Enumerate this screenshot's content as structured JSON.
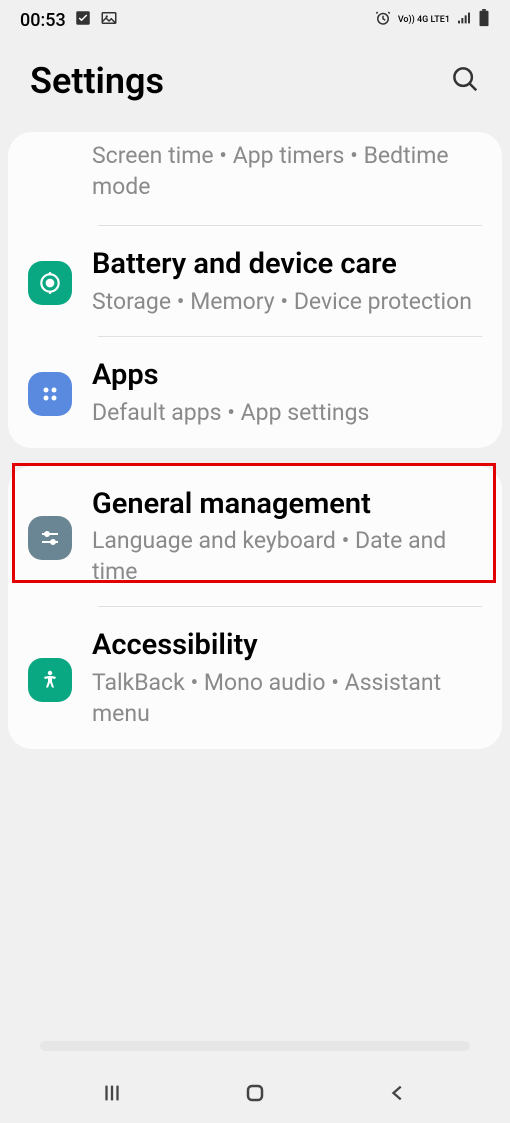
{
  "status_bar": {
    "time": "00:53",
    "network_label": "Vo)) 4G LTE1"
  },
  "header": {
    "title": "Settings"
  },
  "cards": [
    {
      "items": [
        {
          "key": "digital_wellbeing_partial",
          "title": "",
          "subtitle": "Screen time  •  App timers  •  Bedtime mode"
        },
        {
          "key": "battery_device_care",
          "title": "Battery and device care",
          "subtitle": "Storage  •  Memory  •  Device protection"
        },
        {
          "key": "apps",
          "title": "Apps",
          "subtitle": "Default apps  •  App settings",
          "highlighted": true
        }
      ]
    },
    {
      "items": [
        {
          "key": "general_management",
          "title": "General management",
          "subtitle": "Language and keyboard  •  Date and time"
        },
        {
          "key": "accessibility",
          "title": "Accessibility",
          "subtitle": "TalkBack  •  Mono audio  •  Assistant menu"
        }
      ]
    }
  ]
}
